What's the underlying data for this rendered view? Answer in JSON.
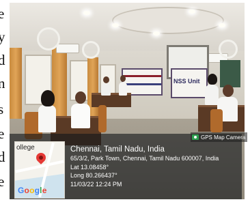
{
  "side_text": {
    "glyphs": [
      "e",
      "y",
      "d",
      "n",
      "s",
      "e",
      "d",
      "e"
    ]
  },
  "photo": {
    "banners": {
      "left": "",
      "right": "NSS Unit"
    }
  },
  "gps_overlay": {
    "badge_label": "GPS Map Camera",
    "map_label": "ollege",
    "map_brand": "Google",
    "city": "Chennai, Tamil Nadu, India",
    "address": "65/3/2, Park Town, Chennai, Tamil Nadu 600007, India",
    "latitude": "Lat 13.08458°",
    "longitude": "Long 80.266437°",
    "datetime": "11/03/22 12:24 PM",
    "pin_color": "#e53935"
  }
}
